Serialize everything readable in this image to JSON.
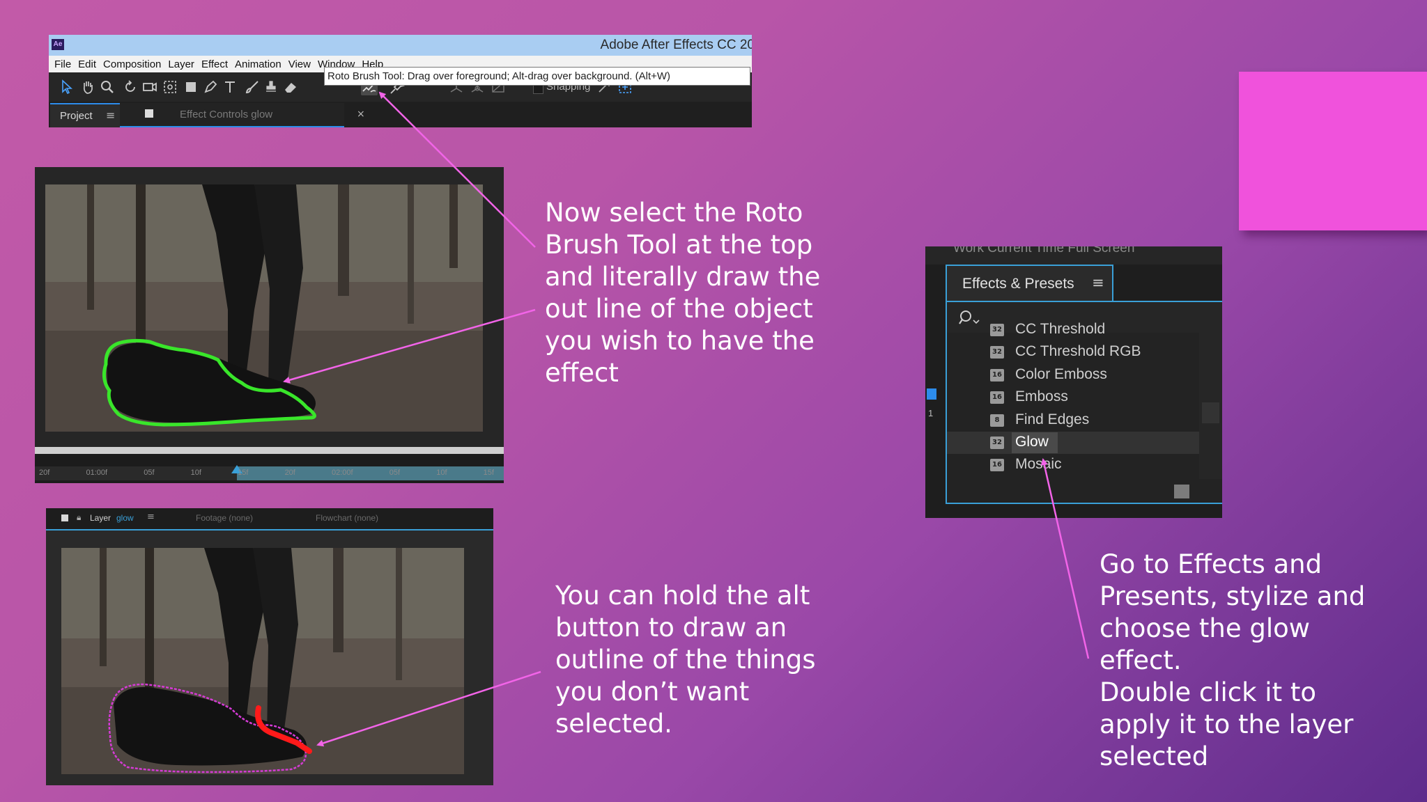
{
  "app": {
    "title": "Adobe After Effects CC 20",
    "logo_text": "Ae",
    "menu": [
      "File",
      "Edit",
      "Composition",
      "Layer",
      "Effect",
      "Animation",
      "View",
      "Window",
      "Help"
    ],
    "toolbar": {
      "snapping_label": "Snapping",
      "tools": [
        "selection-tool-icon",
        "hand-tool-icon",
        "zoom-tool-icon",
        "rotate-tool-icon",
        "camera-tool-icon",
        "pan-behind-tool-icon",
        "rectangle-tool-icon",
        "pen-tool-icon",
        "type-tool-icon",
        "brush-tool-icon",
        "clone-stamp-tool-icon",
        "eraser-tool-icon",
        "roto-brush-tool-icon",
        "puppet-pin-tool-icon"
      ]
    },
    "tabs": {
      "project_label": "Project",
      "menu_glyph": "≡",
      "effect_controls_label": "Effect Controls glow",
      "close_glyph": "×"
    },
    "tooltip": "Roto Brush Tool: Drag over foreground; Alt-drag over background. (Alt+W)"
  },
  "shot_1": {
    "timeline_ticks": [
      "20f",
      "01:00f",
      "05f",
      "10f",
      "15f",
      "20f",
      "02:00f",
      "05f",
      "10f",
      "15f"
    ]
  },
  "shot_2": {
    "header": {
      "layer_label": "Layer",
      "layer_name": "glow",
      "footage_label": "Footage (none)",
      "flowchart_label": "Flowchart (none)"
    }
  },
  "callouts": {
    "roto": "Now select the Roto\nBrush Tool at the top\nand literally draw the\nout line of the object\nyou wish to have the\neffect",
    "alt": "You can hold the alt\nbutton to draw an\noutline of the things\nyou don’t want\nselected.",
    "effects": "Go to Effects and\nPresents, stylize and\nchoose the glow\neffect.\nDouble click it to\napply it to the layer\nselected"
  },
  "effects_panel": {
    "top_strip_text": "Work Current Time      Full Screen",
    "tab_label": "Effects & Presets",
    "menu_glyph": "≡",
    "left_number": "1",
    "items": [
      {
        "label": "CC Threshold",
        "badge": "32"
      },
      {
        "label": "CC Threshold RGB",
        "badge": "32"
      },
      {
        "label": "Color Emboss",
        "badge": "16"
      },
      {
        "label": "Emboss",
        "badge": "16"
      },
      {
        "label": "Find Edges",
        "badge": "8"
      },
      {
        "label": "Glow",
        "badge": "32"
      },
      {
        "label": "Mosaic",
        "badge": "16"
      }
    ],
    "selected_item": "Glow"
  },
  "colors": {
    "accent_blue": "#3aa0d8",
    "roto_outline_green": "#39e62a",
    "roto_outline_magenta": "#d63bd6",
    "background_stroke_red": "#ff1a1a",
    "arrow_pink": "#f264e8",
    "pink_square": "#f052dc"
  }
}
